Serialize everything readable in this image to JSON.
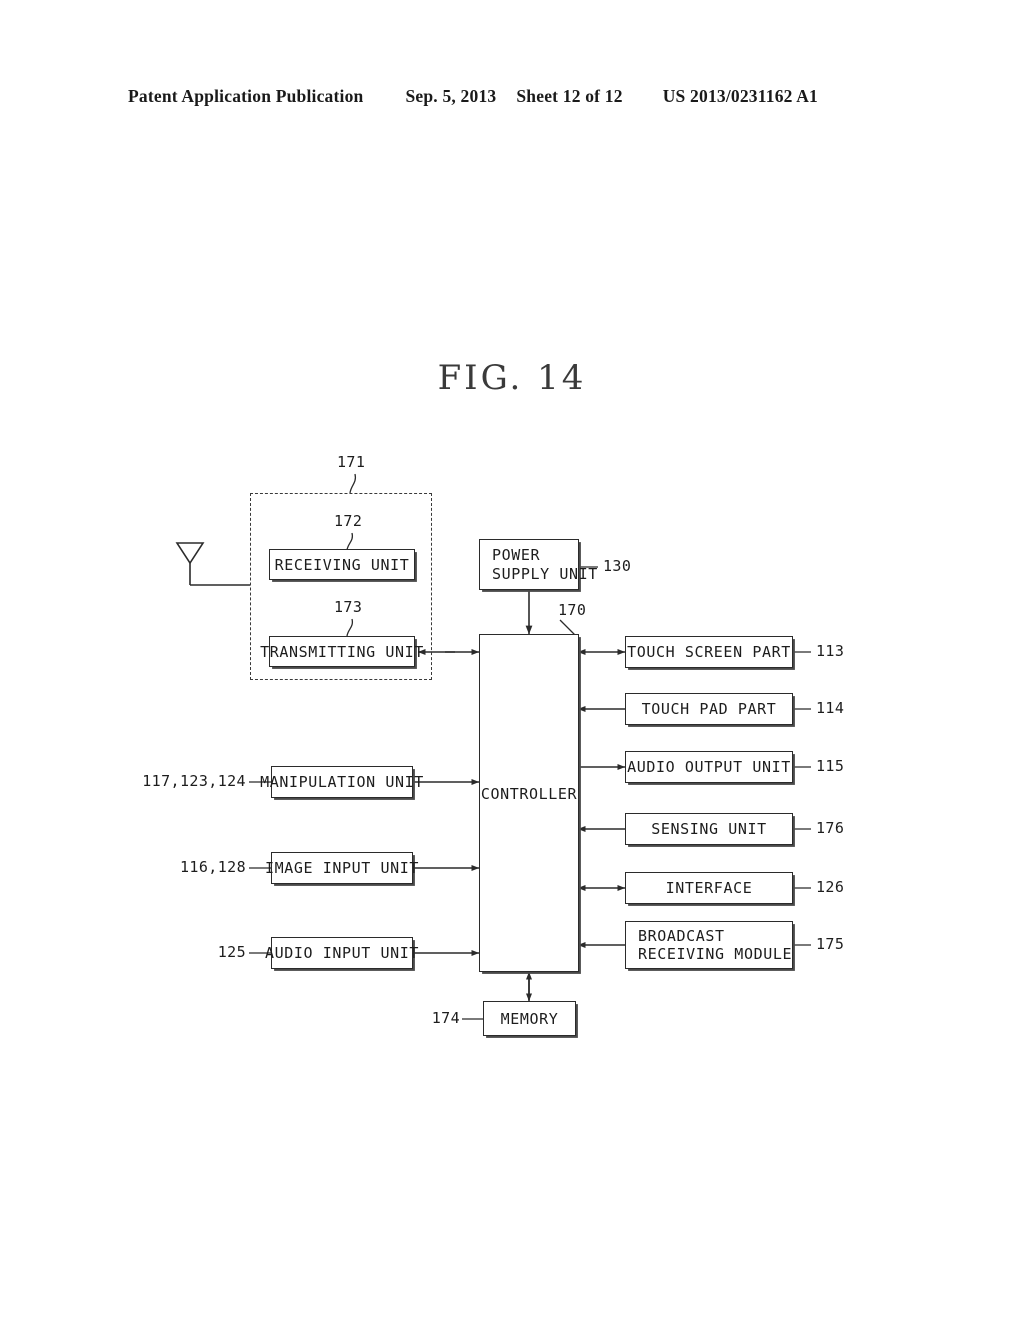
{
  "header": {
    "publication": "Patent Application Publication",
    "date": "Sep. 5, 2013",
    "sheet": "Sheet 12 of 12",
    "number": "US 2013/0231162 A1"
  },
  "figure": {
    "title": "FIG.  14"
  },
  "diagram": {
    "group_171": {
      "ref": "171"
    },
    "nodes": {
      "receiving_unit": {
        "label": "RECEIVING  UNIT",
        "ref": "172"
      },
      "transmitting_unit": {
        "label": "TRANSMITTING  UNIT",
        "ref": "173"
      },
      "power_supply": {
        "label_line1": "POWER",
        "label_line2": "SUPPLY  UNIT",
        "ref": "130"
      },
      "controller": {
        "label": "CONTROLLER",
        "ref": "170"
      },
      "memory": {
        "label": "MEMORY",
        "ref": "174"
      },
      "touch_screen": {
        "label": "TOUCH  SCREEN  PART",
        "ref": "113"
      },
      "touch_pad": {
        "label": "TOUCH  PAD  PART",
        "ref": "114"
      },
      "audio_output": {
        "label": "AUDIO  OUTPUT  UNIT",
        "ref": "115"
      },
      "sensing_unit": {
        "label": "SENSING  UNIT",
        "ref": "176"
      },
      "interface": {
        "label": "INTERFACE",
        "ref": "126"
      },
      "broadcast_module": {
        "label_line1": "BROADCAST",
        "label_line2": "RECEIVING  MODULE",
        "ref": "175"
      },
      "manipulation_unit": {
        "label": "MANIPULATION  UNIT",
        "ref": "117,123,124"
      },
      "image_input_unit": {
        "label": "IMAGE  INPUT  UNIT",
        "ref": "116,128"
      },
      "audio_input_unit": {
        "label": "AUDIO  INPUT  UNIT",
        "ref": "125"
      }
    },
    "antenna": {
      "name": "antenna-symbol"
    }
  }
}
